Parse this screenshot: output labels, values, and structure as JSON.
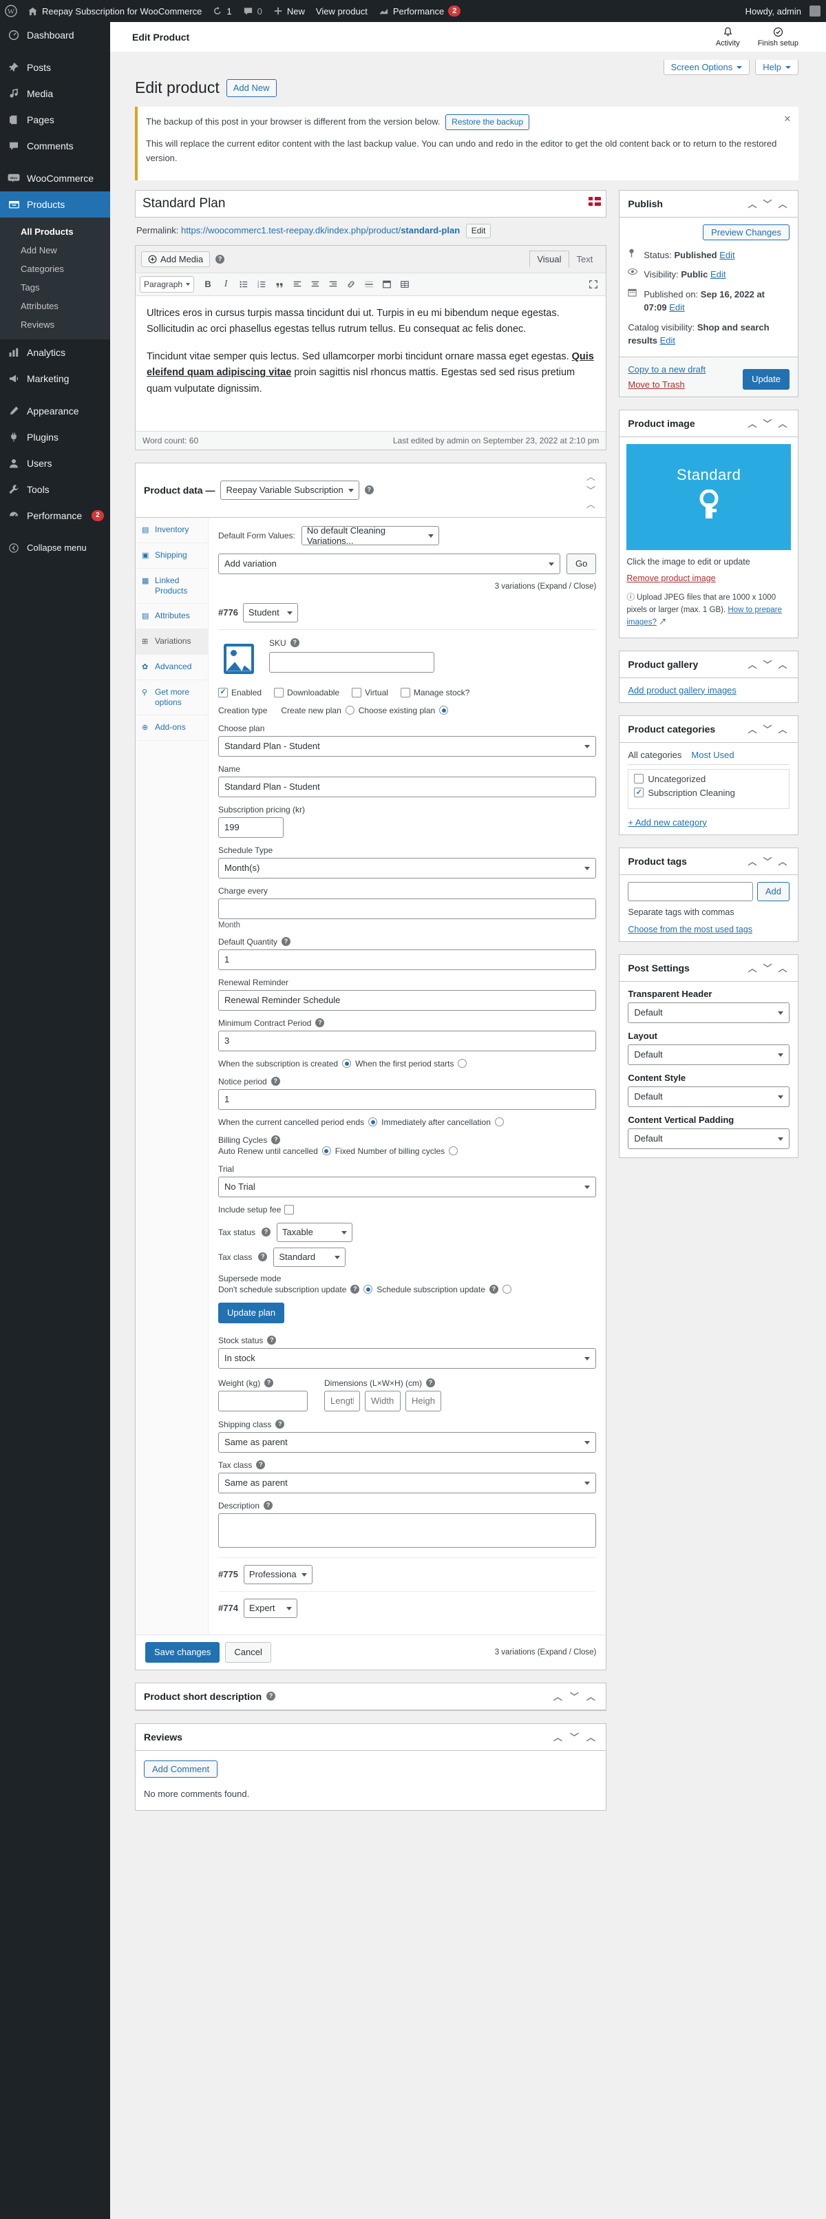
{
  "adminbar": {
    "site_name": "Reepay Subscription for WooCommerce",
    "updates_count": "1",
    "comments_count": "0",
    "new_label": "New",
    "view_product_label": "View product",
    "performance_label": "Performance",
    "performance_badge": "2",
    "howdy": "Howdy, admin"
  },
  "sidebar": {
    "items": [
      {
        "label": "Dashboard",
        "icon": "dashboard-icon"
      },
      {
        "label": "Posts",
        "icon": "pin-icon"
      },
      {
        "label": "Media",
        "icon": "media-icon"
      },
      {
        "label": "Pages",
        "icon": "pages-icon"
      },
      {
        "label": "Comments",
        "icon": "comment-icon"
      },
      {
        "label": "WooCommerce",
        "icon": "woo-icon"
      },
      {
        "label": "Products",
        "icon": "products-icon",
        "current": true
      },
      {
        "label": "Analytics",
        "icon": "analytics-icon"
      },
      {
        "label": "Marketing",
        "icon": "marketing-icon"
      },
      {
        "label": "Appearance",
        "icon": "appearance-icon"
      },
      {
        "label": "Plugins",
        "icon": "plugins-icon"
      },
      {
        "label": "Users",
        "icon": "users-icon"
      },
      {
        "label": "Tools",
        "icon": "tools-icon"
      },
      {
        "label": "Performance",
        "icon": "performance-icon",
        "badge": "2"
      }
    ],
    "submenu": [
      "All Products",
      "Add New",
      "Categories",
      "Tags",
      "Attributes",
      "Reviews"
    ],
    "submenu_current": "All Products",
    "collapse_label": "Collapse menu"
  },
  "topbar": {
    "breadcrumb": "Edit Product",
    "activity_label": "Activity",
    "finish_setup_label": "Finish setup"
  },
  "screen_meta": {
    "screen_options": "Screen Options",
    "help": "Help"
  },
  "page": {
    "title": "Edit product",
    "add_new": "Add New"
  },
  "notice": {
    "line1": "The backup of this post in your browser is different from the version below.",
    "restore_label": "Restore the backup",
    "line2": "This will replace the current editor content with the last backup value. You can undo and redo in the editor to get the old content back or to return to the restored version."
  },
  "editor": {
    "product_title": "Standard Plan",
    "permalink_label": "Permalink:",
    "permalink_url": "https://woocommerc1.test-reepay.dk/index.php/product/",
    "permalink_slug": "standard-plan",
    "permalink_edit": "Edit",
    "add_media": "Add Media",
    "tab_visual": "Visual",
    "tab_text": "Text",
    "paragraph_select": "Paragraph",
    "body_p1": "Ultrices eros in cursus turpis massa tincidunt dui ut. Turpis in eu mi bibendum neque egestas. Sollicitudin ac orci phasellus egestas tellus rutrum tellus. Eu consequat ac felis donec.",
    "body_p2_a": "Tincidunt vitae semper quis lectus. Sed ullamcorper morbi tincidunt ornare massa eget egestas. ",
    "body_p2_u": "Quis eleifend quam adipiscing vitae",
    "body_p2_b": " proin sagittis nisl rhoncus mattis. Egestas sed sed risus pretium quam vulputate dignissim.",
    "word_count": "Word count: 60",
    "last_edited": "Last edited by admin on September 23, 2022 at 2:10 pm"
  },
  "product_data": {
    "heading": "Product data —",
    "type_select": "Reepay Variable Subscription",
    "tabs": [
      {
        "label": "Inventory",
        "icon": "inventory-icon"
      },
      {
        "label": "Shipping",
        "icon": "shipping-icon"
      },
      {
        "label": "Linked Products",
        "icon": "link-icon"
      },
      {
        "label": "Attributes",
        "icon": "attributes-icon"
      },
      {
        "label": "Variations",
        "icon": "variations-icon",
        "active": true
      },
      {
        "label": "Advanced",
        "icon": "gear-icon"
      },
      {
        "label": "Get more options",
        "icon": "plug-icon"
      },
      {
        "label": "Add-ons",
        "icon": "plus-circle-icon"
      }
    ],
    "default_form_label": "Default Form Values:",
    "default_form_value": "No default Cleaning Variations...",
    "add_variation_value": "Add variation",
    "go_label": "Go",
    "variation_count_top": "3 variations (Expand / Close)",
    "variation_count_bottom": "3 variations (Expand / Close)",
    "save_changes": "Save changes",
    "cancel": "Cancel"
  },
  "variation": {
    "id": "#776",
    "attribute_value": "Student",
    "sku_label": "SKU",
    "sku_value": "",
    "checkboxes": [
      {
        "label": "Enabled",
        "checked": true
      },
      {
        "label": "Downloadable",
        "checked": false
      },
      {
        "label": "Virtual",
        "checked": false
      },
      {
        "label": "Manage stock?",
        "checked": false
      }
    ],
    "creation_type_label": "Creation type",
    "creation_new_plan": "Create new plan",
    "creation_existing_plan": "Choose existing plan",
    "choose_plan_label": "Choose plan",
    "choose_plan_value": "Standard Plan - Student",
    "name_label": "Name",
    "name_value": "Standard Plan - Student",
    "pricing_label": "Subscription pricing (kr)",
    "pricing_value": "199",
    "schedule_type_label": "Schedule Type",
    "schedule_type_value": "Month(s)",
    "charge_every_label": "Charge every",
    "charge_every_value": "",
    "charge_every_hint": "Month",
    "default_quantity_label": "Default Quantity",
    "default_quantity_value": "1",
    "renewal_reminder_label": "Renewal Reminder",
    "renewal_reminder_value": "Renewal Reminder Schedule",
    "min_contract_label": "Minimum Contract Period",
    "min_contract_value": "3",
    "when_created_label": "When the subscription is created",
    "when_first_period_label": "When the first period starts",
    "notice_period_label": "Notice period",
    "notice_period_value": "1",
    "when_cancelled_label": "When the current cancelled period ends",
    "immediately_label": "Immediately after cancellation",
    "billing_cycles_label": "Billing Cycles",
    "auto_renew_label": "Auto Renew until cancelled",
    "fixed_cycles_label": "Fixed Number of billing cycles",
    "trial_label": "Trial",
    "trial_value": "No Trial",
    "include_setup_fee": "Include setup fee",
    "tax_status_label": "Tax status",
    "tax_status_value": "Taxable",
    "tax_class_label": "Tax class",
    "tax_class_value": "Standard",
    "supersede_label": "Supersede mode",
    "dont_schedule_label": "Don't schedule subscription update",
    "schedule_update_label": "Schedule subscription update",
    "update_plan_btn": "Update plan",
    "stock_status_label": "Stock status",
    "stock_status_value": "In stock",
    "weight_label": "Weight (kg)",
    "weight_value": "",
    "dimensions_label": "Dimensions (L×W×H) (cm)",
    "dim_length": "Length",
    "dim_width": "Width",
    "dim_height": "Height",
    "shipping_class_label": "Shipping class",
    "shipping_class_value": "Same as parent",
    "tax_class2_label": "Tax class",
    "tax_class2_value": "Same as parent",
    "description_label": "Description",
    "description_value": ""
  },
  "other_variations": [
    {
      "id": "#775",
      "value": "Professiona"
    },
    {
      "id": "#774",
      "value": "Expert"
    }
  ],
  "publish": {
    "title": "Publish",
    "preview_changes": "Preview Changes",
    "status_label": "Status:",
    "status_value": "Published",
    "visibility_label": "Visibility:",
    "visibility_value": "Public",
    "published_label": "Published on:",
    "published_value": "Sep 16, 2022 at 07:09",
    "catalog_label": "Catalog visibility:",
    "catalog_value": "Shop and search results",
    "edit_label": "Edit",
    "copy_draft": "Copy to a new draft",
    "move_trash": "Move to Trash",
    "update_btn": "Update"
  },
  "product_image": {
    "title": "Product image",
    "placeholder_word": "Standard",
    "caption": "Click the image to edit or update",
    "remove_label": "Remove product image",
    "upload_note": "Upload JPEG files that are 1000 x 1000 pixels or larger (max. 1 GB).",
    "how_to_link": "How to prepare images?"
  },
  "product_gallery": {
    "title": "Product gallery",
    "add_link": "Add product gallery images"
  },
  "product_categories": {
    "title": "Product categories",
    "tab_all": "All categories",
    "tab_most_used": "Most Used",
    "items": [
      {
        "label": "Uncategorized",
        "checked": false
      },
      {
        "label": "Subscription Cleaning",
        "checked": true
      }
    ],
    "add_new": "+ Add new category"
  },
  "product_tags": {
    "title": "Product tags",
    "input_value": "",
    "add_label": "Add",
    "hint": "Separate tags with commas",
    "most_used_link": "Choose from the most used tags"
  },
  "post_settings": {
    "title": "Post Settings",
    "fields": [
      {
        "label": "Transparent Header",
        "value": "Default"
      },
      {
        "label": "Layout",
        "value": "Default"
      },
      {
        "label": "Content Style",
        "value": "Default"
      },
      {
        "label": "Content Vertical Padding",
        "value": "Default"
      }
    ]
  },
  "short_description": {
    "title": "Product short description"
  },
  "reviews": {
    "title": "Reviews",
    "add_comment": "Add Comment",
    "empty": "No more comments found."
  },
  "colors": {
    "accent": "#2271b1",
    "sidebar_bg": "#1d2327",
    "notice_border": "#dba617",
    "danger": "#d63638",
    "product_img_bg": "#29abe2"
  }
}
